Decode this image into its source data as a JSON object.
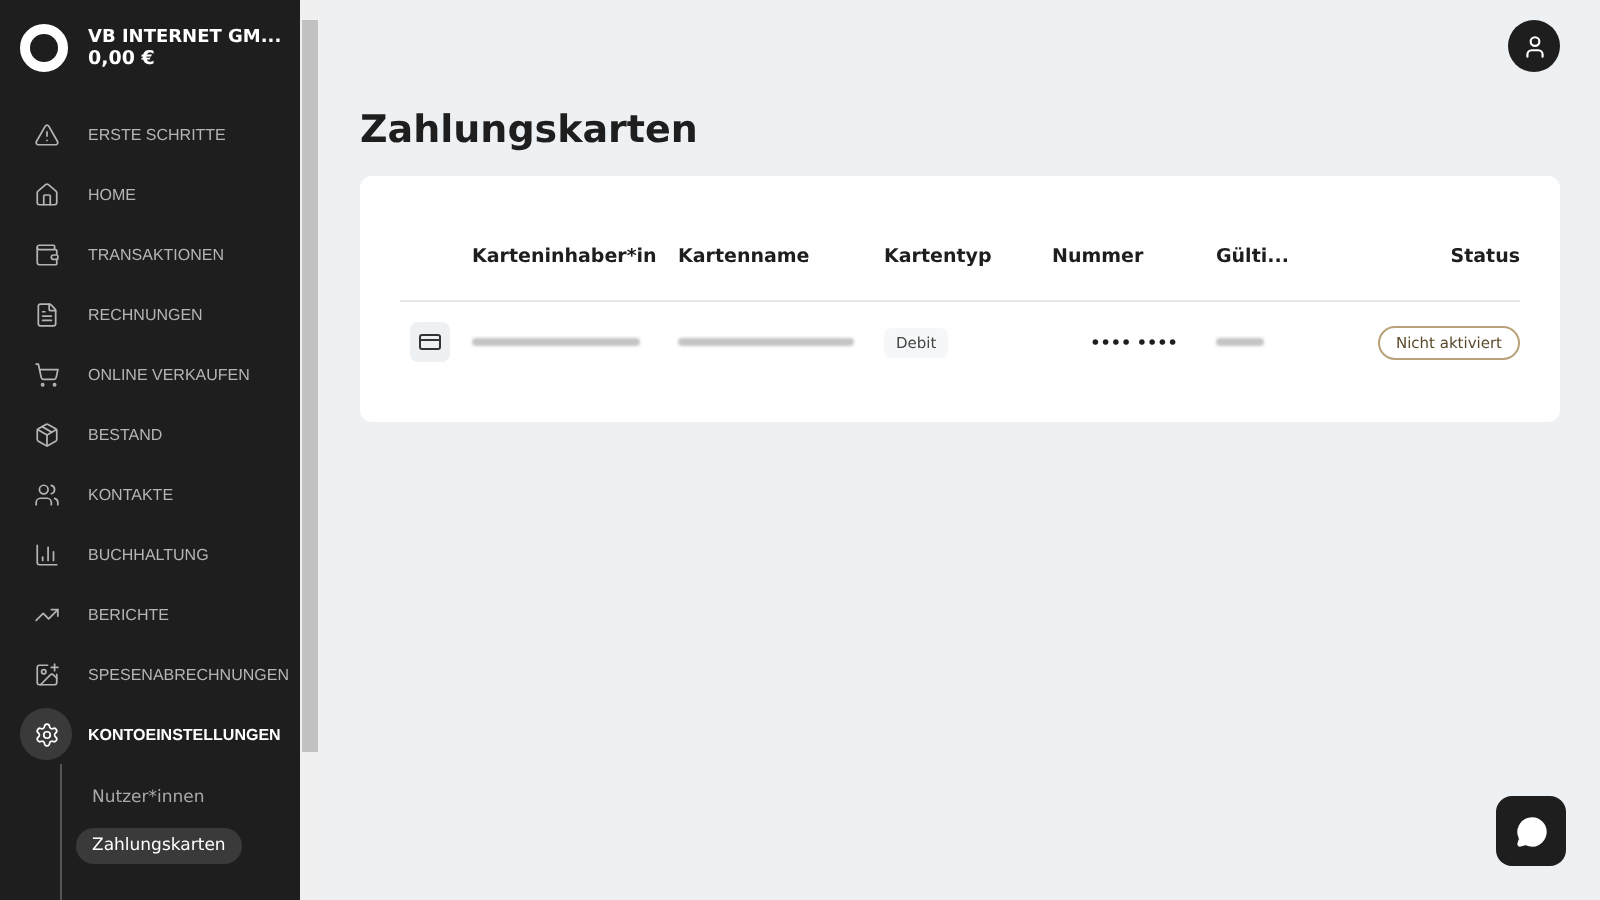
{
  "account": {
    "name": "VB INTERNET GM...",
    "balance": "0,00 €"
  },
  "nav": [
    {
      "label": "ERSTE SCHRITTE",
      "selected": false
    },
    {
      "label": "HOME",
      "selected": false
    },
    {
      "label": "TRANSAKTIONEN",
      "selected": false
    },
    {
      "label": "RECHNUNGEN",
      "selected": false
    },
    {
      "label": "ONLINE VERKAUFEN",
      "selected": false
    },
    {
      "label": "BESTAND",
      "selected": false
    },
    {
      "label": "KONTAKTE",
      "selected": false
    },
    {
      "label": "BUCHHALTUNG",
      "selected": false
    },
    {
      "label": "BERICHTE",
      "selected": false
    },
    {
      "label": "SPESENABRECHNUNGEN",
      "selected": false
    },
    {
      "label": "KONTOEINSTELLUNGEN",
      "selected": true,
      "expanded": true,
      "children": [
        {
          "label": "Nutzer*innen",
          "selected": false
        },
        {
          "label": "Zahlungskarten",
          "selected": true
        }
      ]
    }
  ],
  "page_title": "Zahlungskarten",
  "table": {
    "columns": [
      "Karteninhaber*in",
      "Kartenname",
      "Kartentyp",
      "Nummer",
      "Gülti...",
      "Status"
    ],
    "rows": [
      {
        "card_type": "Debit",
        "number": "•••• ••••",
        "status": "Nicht aktiviert"
      }
    ]
  }
}
